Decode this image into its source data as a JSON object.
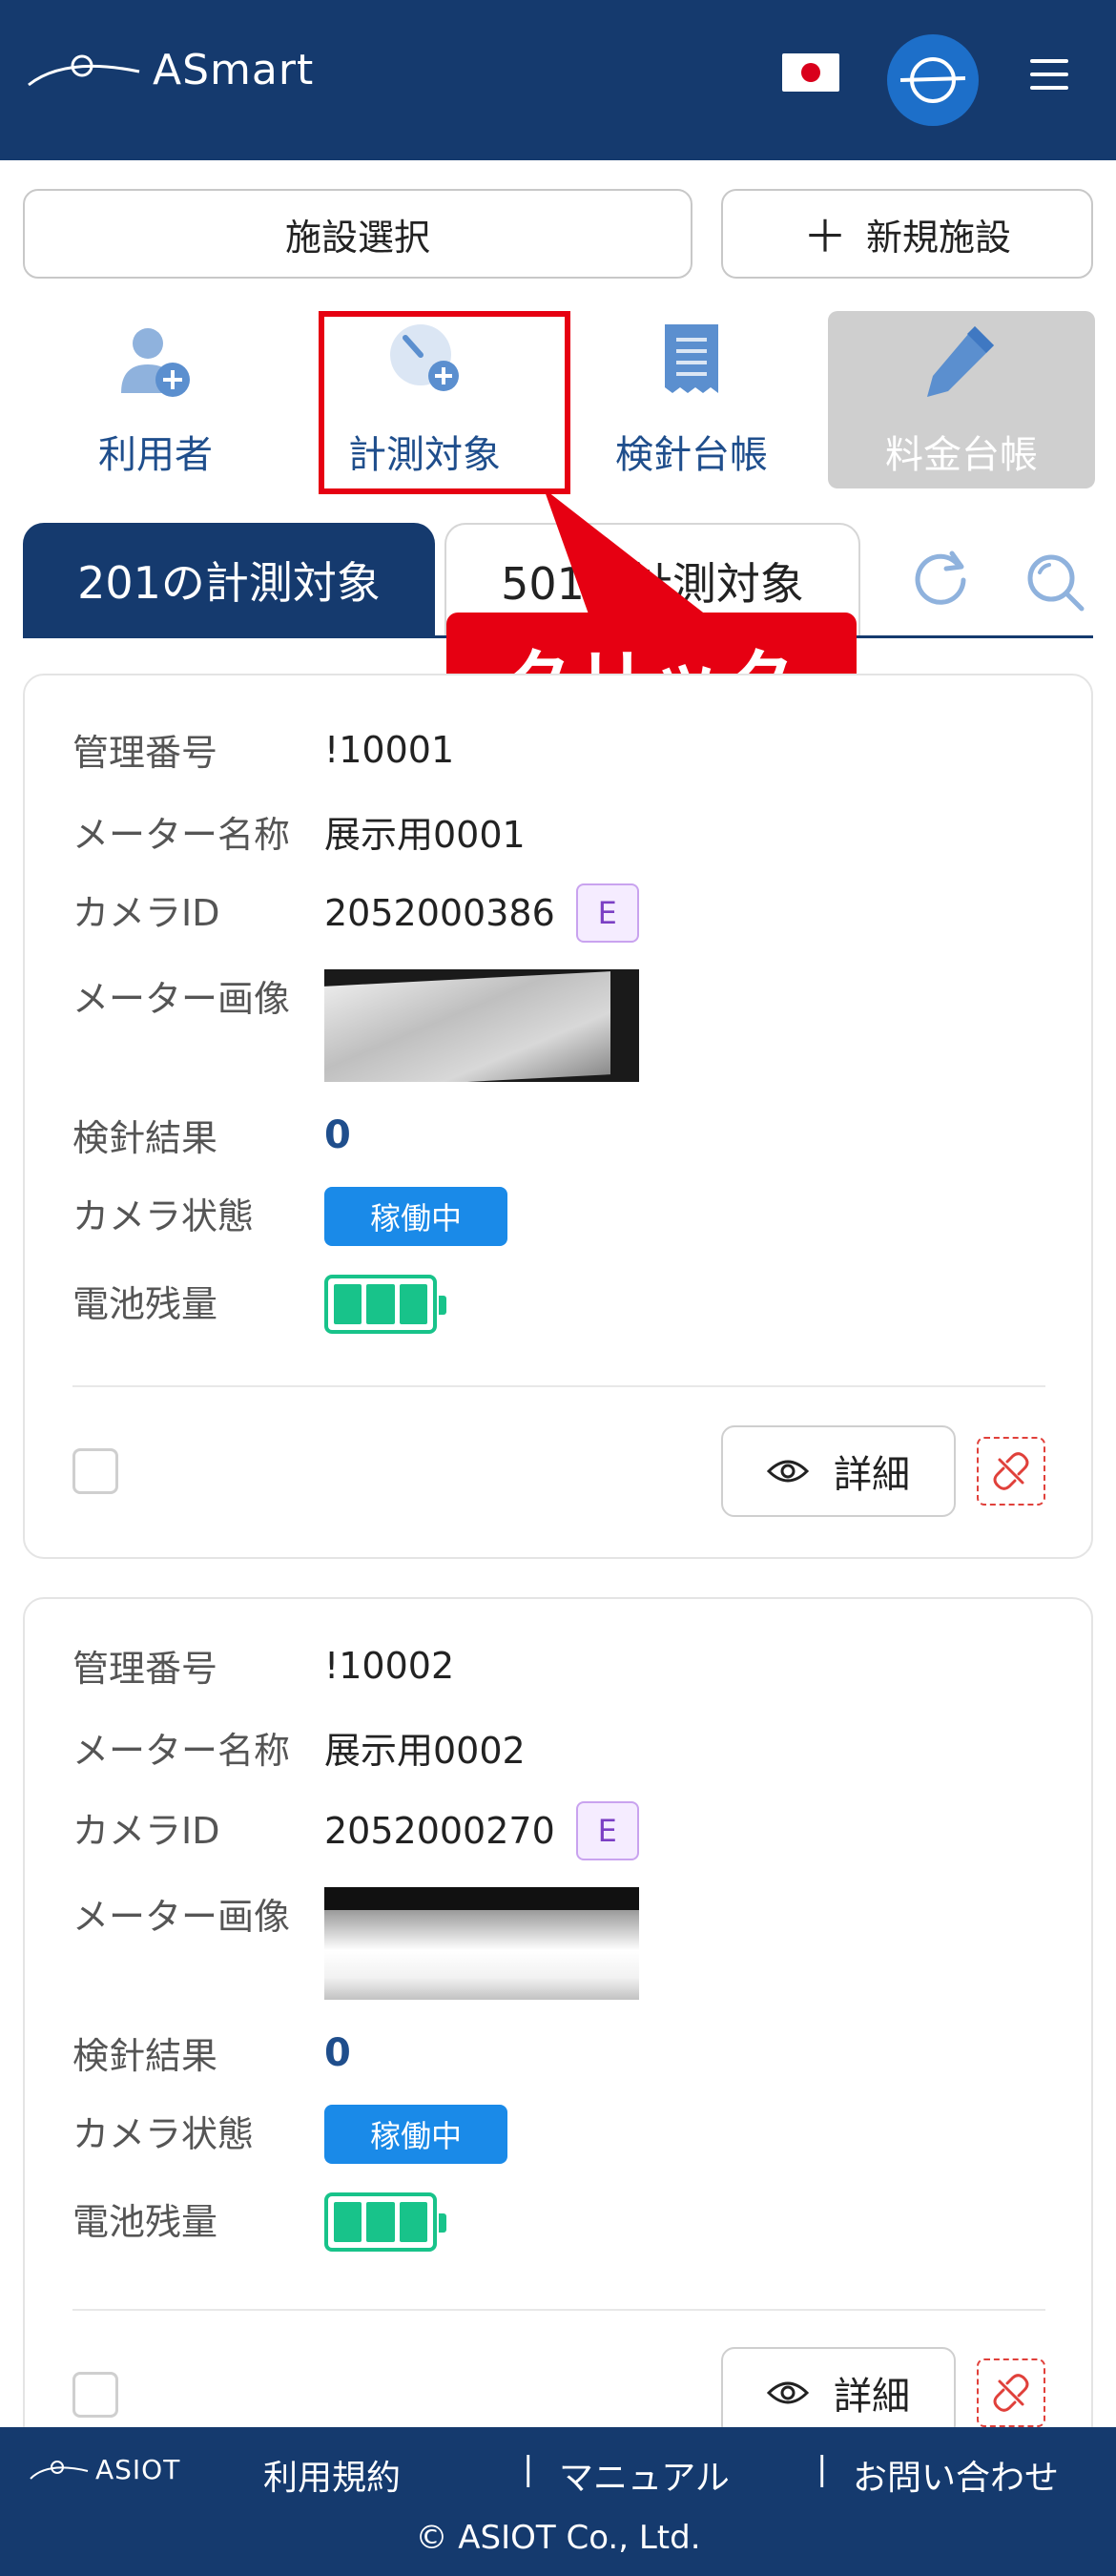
{
  "header": {
    "app_name": "ASmart"
  },
  "top_buttons": {
    "facility_select": "施設選択",
    "new_facility_plus": "＋",
    "new_facility": "新規施設"
  },
  "nav": {
    "users": "利用者",
    "targets": "計測対象",
    "meter_ledger": "検針台帳",
    "billing_ledger": "料金台帳"
  },
  "tabs": {
    "active": "201の計測対象",
    "inactive": "501の計測対象"
  },
  "callout": "クリック",
  "labels": {
    "mgmt_no": "管理番号",
    "meter_name": "メーター名称",
    "camera_id": "カメラID",
    "meter_image": "メーター画像",
    "reading_result": "検針結果",
    "camera_status": "カメラ状態",
    "battery": "電池残量"
  },
  "cards": [
    {
      "mgmt_no": "!10001",
      "meter_name": "展示用0001",
      "camera_id": "2052000386",
      "badge": "E",
      "reading_result": "0",
      "camera_status": "稼働中",
      "battery_level": 1.0,
      "detail_label": "詳細"
    },
    {
      "mgmt_no": "!10002",
      "meter_name": "展示用0002",
      "camera_id": "2052000270",
      "badge": "E",
      "reading_result": "0",
      "camera_status": "稼働中",
      "battery_level": 1.0,
      "detail_label": "詳細"
    }
  ],
  "footer": {
    "logo": "ASIOT",
    "terms": "利用規約",
    "manual": "マニュアル",
    "contact": "お問い合わせ",
    "separator": "|",
    "copyright": "© ASIOT Co., Ltd."
  },
  "colors": {
    "primary": "#153a6e",
    "accent_blue": "#1a8ae8",
    "battery_green": "#18c38a",
    "highlight_red": "#e60012"
  },
  "icons": {
    "users": "user-add-icon",
    "targets": "gauge-add-icon",
    "meter_ledger": "receipt-icon",
    "billing_ledger": "pencil-icon",
    "refresh": "refresh-icon",
    "search": "search-icon",
    "menu": "hamburger-menu-icon",
    "detail": "eye-icon",
    "unlink": "unlink-icon"
  }
}
